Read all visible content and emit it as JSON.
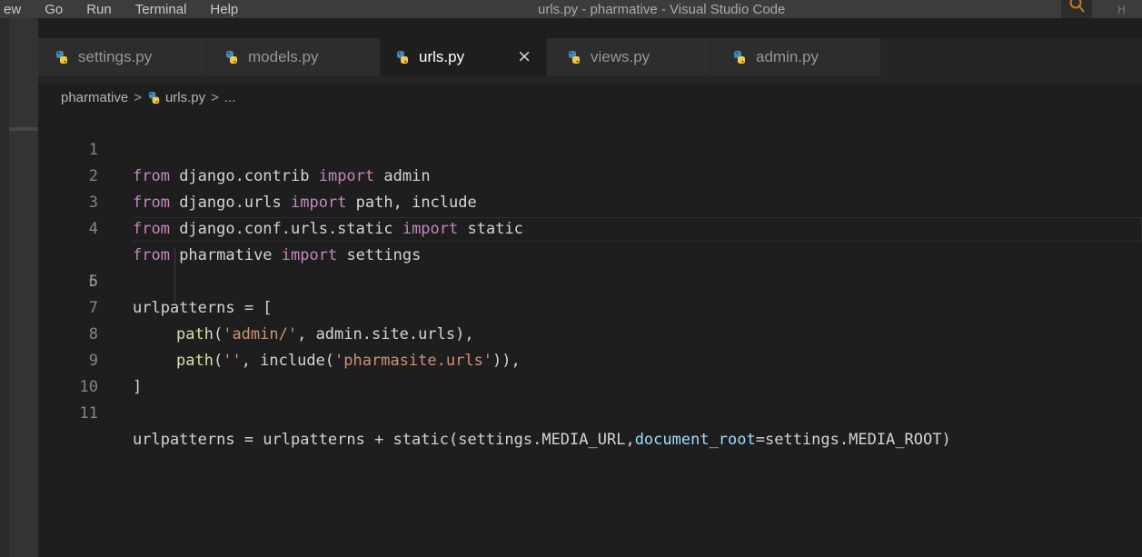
{
  "window": {
    "menu": [
      "ew",
      "Go",
      "Run",
      "Terminal",
      "Help"
    ],
    "title": "urls.py - pharmative - Visual Studio Code",
    "title_right": "H"
  },
  "tabs": [
    {
      "label": "settings.py",
      "active": false
    },
    {
      "label": "models.py",
      "active": false
    },
    {
      "label": "urls.py",
      "active": true,
      "close": "×"
    },
    {
      "label": "views.py",
      "active": false
    },
    {
      "label": "admin.py",
      "active": false
    }
  ],
  "breadcrumb": {
    "folder": "pharmative",
    "separator": ">",
    "file": "urls.py",
    "more": "..."
  },
  "editor": {
    "current_line": 5,
    "lines": [
      {
        "n": "1"
      },
      {
        "n": "2"
      },
      {
        "n": "3"
      },
      {
        "n": "4"
      },
      {
        "n": "5"
      },
      {
        "n": "6"
      },
      {
        "n": "7"
      },
      {
        "n": "8"
      },
      {
        "n": "9"
      },
      {
        "n": "10"
      },
      {
        "n": "11"
      }
    ],
    "tokens": {
      "from": "from",
      "import": "import",
      "l1_mod": " django.contrib ",
      "l1_name": " admin",
      "l2_mod": " django.urls ",
      "l2_name": " path, include",
      "l3_mod": " django.conf.urls.static ",
      "l3_name": " static",
      "l4_mod": " pharmative ",
      "l4_name": " settings",
      "urlpatterns_open": "urlpatterns = [",
      "path": "path",
      "l7_open": "(",
      "l7_str": "'admin/'",
      "l7_rest": ", admin.site.urls),",
      "l8_open": "(",
      "l8_str1": "''",
      "l8_mid": ", include(",
      "l8_str2": "'pharmasite.urls'",
      "l8_rest": ")),",
      "close_bracket": "]",
      "l11_a": "urlpatterns = urlpatterns + static(settings.MEDIA_URL,",
      "l11_kwarg": "document_root",
      "l11_b": "=settings.MEDIA_ROOT)"
    }
  },
  "colors": {
    "background": "#1e1e1e",
    "keyword": "#c586c0",
    "string": "#ce9178",
    "text": "#d4d4d4",
    "parameter": "#9cdcfe",
    "line_number": "#858585",
    "python_icon_blue": "#3c8ab8",
    "python_icon_yellow": "#f3c84a"
  }
}
